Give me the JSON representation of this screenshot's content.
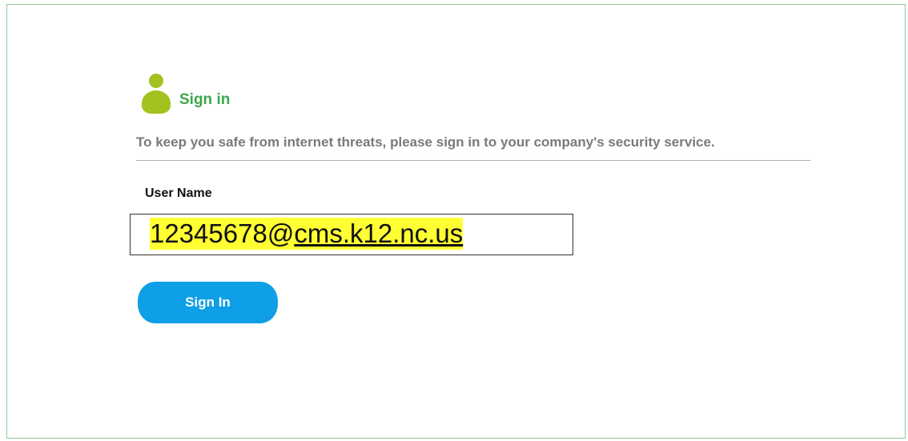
{
  "header": {
    "icon": "user-icon",
    "title": "Sign in"
  },
  "description": "To keep you safe from internet threats, please sign in to your company's security service.",
  "form": {
    "username_label": "User Name",
    "username_value_local": "12345678@",
    "username_value_domain": "cms.k12.nc.us",
    "highlight_color": "#ffff33",
    "submit_label": "Sign In"
  },
  "colors": {
    "title_green": "#3aa84a",
    "icon_green": "#a3c21f",
    "button_blue": "#0e9fe6",
    "frame_border": "#8fcb9b"
  }
}
